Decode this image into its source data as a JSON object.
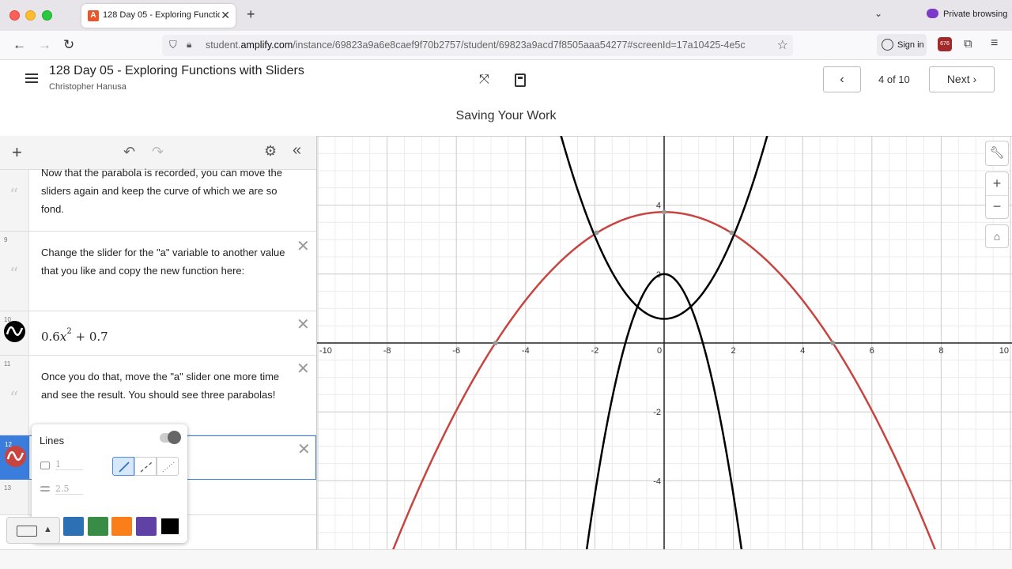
{
  "browser": {
    "tab_title": "128 Day 05 - Exploring Function",
    "tab_favicon": "A",
    "private_label": "Private browsing",
    "url_prefix": "student.",
    "url_domain": "amplify.com",
    "url_path": "/instance/69823a9a6e8caef9f70b2757/student/69823a9acd7f8505aaa54277#screenId=17a10425-4e5c",
    "sign_in_label": "Sign in",
    "extension_badge": "676"
  },
  "header": {
    "lesson_title": "128 Day 05 - Exploring Functions with Sliders",
    "author": "Christopher Hanusa",
    "page_indicator": "4 of 10",
    "next_label": "Next"
  },
  "screen_title": "Saving Your Work",
  "expressions": [
    {
      "num": "",
      "type": "note",
      "text": "Now that the parabola is recorded, you can move the sliders again and keep the curve of which we are so fond."
    },
    {
      "num": "9",
      "type": "note",
      "text": "Change the slider for the \"a\" variable to another value that you like and copy the new function here:"
    },
    {
      "num": "10",
      "type": "math",
      "coef": "0.6",
      "var": "x",
      "exp": "2",
      "rest": "+ 0.7"
    },
    {
      "num": "11",
      "type": "note",
      "text": "Once you do that, move the \"a\" slider one more time and see the result. You should see three parabolas!"
    },
    {
      "num": "12",
      "type": "math-selected"
    },
    {
      "num": "13",
      "type": "empty"
    }
  ],
  "style_popup": {
    "title": "Lines",
    "opacity_value": "1",
    "width_value": "2.5",
    "colors": [
      "#c74440",
      "#2d70b3",
      "#388c46",
      "#fa7e19",
      "#6042a6",
      "#000000"
    ],
    "selected_color": "#000000"
  },
  "graph": {
    "x_ticks": [
      "-10",
      "-8",
      "-6",
      "-4",
      "-2",
      "0",
      "2",
      "4",
      "6",
      "8",
      "10"
    ],
    "y_ticks": [
      "4",
      "2",
      "-2",
      "-4"
    ],
    "curve_red_color": "#c74440",
    "curve_black_color": "#000000"
  }
}
